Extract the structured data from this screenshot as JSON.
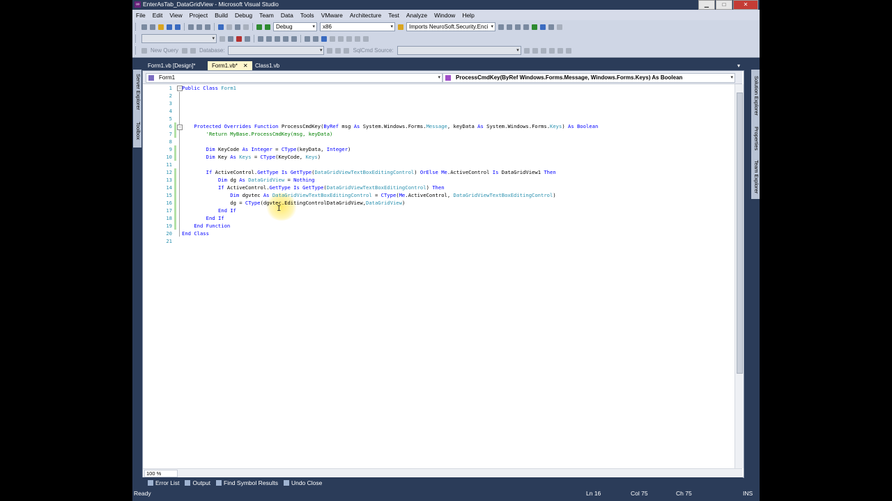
{
  "window": {
    "title": "EnterAsTab_DataGridView - Microsoft Visual Studio"
  },
  "menu": [
    "File",
    "Edit",
    "View",
    "Project",
    "Build",
    "Debug",
    "Team",
    "Data",
    "Tools",
    "VMware",
    "Architecture",
    "Test",
    "Analyze",
    "Window",
    "Help"
  ],
  "toolbar": {
    "configuration": "Debug",
    "platform": "x86",
    "find": "Imports NeuroSoft.Security.Enci",
    "new_query": "New Query",
    "database_label": "Database:",
    "sqlcmd_source": "SqlCmd Source:"
  },
  "side_tabs": {
    "left": [
      "Server Explorer",
      "Toolbox"
    ],
    "right": [
      "Solution Explorer",
      "Properties",
      "Team Explorer"
    ]
  },
  "doc_tabs": [
    {
      "label": "Form1.vb [Design]*"
    },
    {
      "label": "Form1.vb*",
      "close": "✕"
    },
    {
      "label": "Class1.vb"
    }
  ],
  "nav": {
    "type_combo": "Form1",
    "member_combo": "ProcessCmdKey(ByRef Windows.Forms.Message, Windows.Forms.Keys) As Boolean"
  },
  "code_lines": [
    {
      "n": "1",
      "t": "Public Class Form1"
    },
    {
      "n": "2",
      "t": ""
    },
    {
      "n": "3",
      "t": ""
    },
    {
      "n": "4",
      "t": ""
    },
    {
      "n": "5",
      "t": ""
    },
    {
      "n": "6",
      "t": "    Protected Overrides Function ProcessCmdKey(ByRef msg As System.Windows.Forms.Message, keyData As System.Windows.Forms.Keys) As Boolean"
    },
    {
      "n": "7",
      "t": "        'Return MyBase.ProcessCmdKey(msg, keyData)"
    },
    {
      "n": "8",
      "t": ""
    },
    {
      "n": "9",
      "t": "        Dim KeyCode As Integer = CType(keyData, Integer)"
    },
    {
      "n": "10",
      "t": "        Dim Key As Keys = CType(KeyCode, Keys)"
    },
    {
      "n": "11",
      "t": ""
    },
    {
      "n": "12",
      "t": "        If ActiveControl.GetType Is GetType(DataGridViewTextBoxEditingControl) OrElse Me.ActiveControl Is DataGridView1 Then"
    },
    {
      "n": "13",
      "t": "            Dim dg As DataGridView = Nothing"
    },
    {
      "n": "14",
      "t": "            If ActiveControl.GetType Is GetType(DataGridViewTextBoxEditingControl) Then"
    },
    {
      "n": "15",
      "t": "                Dim dgvtec As DataGridViewTextBoxEditingControl = CType(Me.ActiveControl, DataGridViewTextBoxEditingControl)"
    },
    {
      "n": "16",
      "t": "                dg = CType(dgvtec.EditingControlDataGridView,DataGridView)"
    },
    {
      "n": "17",
      "t": "            End If"
    },
    {
      "n": "18",
      "t": "        End If"
    },
    {
      "n": "19",
      "t": "    End Function"
    },
    {
      "n": "20",
      "t": "End Class"
    },
    {
      "n": "21",
      "t": ""
    }
  ],
  "zoom": "100 %",
  "bottom_tabs": [
    "Error List",
    "Output",
    "Find Symbol Results",
    "Undo Close"
  ],
  "status": {
    "text": "Ready",
    "ln": "Ln 16",
    "col": "Col 75",
    "ch": "Ch 75",
    "mode": "INS"
  },
  "colors": {
    "keyword": "#0000ff",
    "type": "#2b91af",
    "comment": "#008000",
    "chrome": "#2b3c59"
  }
}
